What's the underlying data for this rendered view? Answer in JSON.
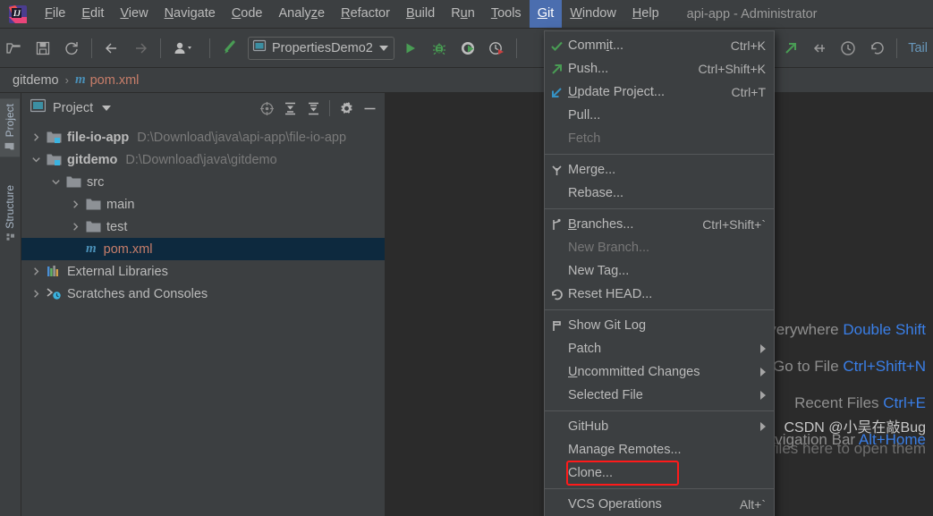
{
  "window": {
    "title": "api-app - Administrator"
  },
  "menubar": {
    "logo_icon": "intellij-idea-logo",
    "items": [
      {
        "label": "File",
        "mnemonic": "F"
      },
      {
        "label": "Edit",
        "mnemonic": "E"
      },
      {
        "label": "View",
        "mnemonic": "V"
      },
      {
        "label": "Navigate",
        "mnemonic": "N"
      },
      {
        "label": "Code",
        "mnemonic": "C"
      },
      {
        "label": "Analyze",
        "mnemonic": "z"
      },
      {
        "label": "Refactor",
        "mnemonic": "R"
      },
      {
        "label": "Build",
        "mnemonic": "B"
      },
      {
        "label": "Run",
        "mnemonic": "u"
      },
      {
        "label": "Tools",
        "mnemonic": "T"
      },
      {
        "label": "Git",
        "mnemonic": "G",
        "active": true
      },
      {
        "label": "Window",
        "mnemonic": "W"
      },
      {
        "label": "Help",
        "mnemonic": "H"
      }
    ]
  },
  "toolbar": {
    "open_icon": "open-folder-icon",
    "save_icon": "save-icon",
    "sync_icon": "refresh-icon",
    "back_icon": "arrow-left-icon",
    "forward_icon": "arrow-right-icon",
    "profile_icon": "user-dropdown-icon",
    "build_icon": "build-hammer-icon",
    "run_config": {
      "label": "PropertiesDemo2",
      "icon": "run-config-icon"
    },
    "run_icon": "run-play-icon",
    "debug_icon": "debug-bug-icon",
    "coverage_icon": "run-with-coverage-icon",
    "profiler_icon": "profiler-icon",
    "jump_icon": "jump-to-source-icon",
    "step_icon": "step-into-icon",
    "history_icon": "clock-history-icon",
    "undo_icon": "undo-icon",
    "right_label": "Tail"
  },
  "breadcrumb": {
    "project": "gitdemo",
    "separator": "›",
    "file_icon_letter": "m",
    "file": "pom.xml"
  },
  "stripe": {
    "tabs": [
      {
        "label": "Project",
        "icon": "project-folder-icon",
        "selected": true
      },
      {
        "label": "Structure",
        "icon": "structure-icon",
        "selected": false
      }
    ]
  },
  "project_panel": {
    "icon": "project-view-icon",
    "title": "Project",
    "dropdown_icon": "chevron-down-icon",
    "header_buttons": [
      {
        "icon": "locate-target-icon",
        "name": "select-opened-file"
      },
      {
        "icon": "expand-all-icon",
        "name": "expand-all"
      },
      {
        "icon": "collapse-all-icon",
        "name": "collapse-all"
      },
      {
        "icon": "gear-icon",
        "name": "settings"
      },
      {
        "icon": "minimize-icon",
        "name": "hide"
      }
    ],
    "tree": [
      {
        "indent": 0,
        "chevron": "right",
        "icon": "module-folder-icon",
        "label": "file-io-app",
        "bold": true,
        "path": "D:\\Download\\java\\api-app\\file-io-app",
        "selected": false
      },
      {
        "indent": 0,
        "chevron": "down",
        "icon": "module-folder-icon",
        "label": "gitdemo",
        "bold": true,
        "path": "D:\\Download\\java\\gitdemo",
        "selected": false
      },
      {
        "indent": 1,
        "chevron": "down",
        "icon": "folder-icon",
        "label": "src",
        "bold": false,
        "path": "",
        "selected": false
      },
      {
        "indent": 2,
        "chevron": "right",
        "icon": "folder-icon",
        "label": "main",
        "bold": false,
        "path": "",
        "selected": false
      },
      {
        "indent": 2,
        "chevron": "right",
        "icon": "folder-icon",
        "label": "test",
        "bold": false,
        "path": "",
        "selected": false
      },
      {
        "indent": 2,
        "chevron": "none",
        "icon": "maven-pom-icon",
        "label": "pom.xml",
        "bold": false,
        "path": "",
        "selected": true
      },
      {
        "indent": 0,
        "chevron": "right",
        "icon": "external-libraries-icon",
        "label": "External Libraries",
        "bold": false,
        "path": "",
        "selected": false
      },
      {
        "indent": 0,
        "chevron": "right",
        "icon": "scratches-icon",
        "label": "Scratches and Consoles",
        "bold": false,
        "path": "",
        "selected": false
      }
    ]
  },
  "editor_tips": [
    {
      "text": "Search Everywhere",
      "key": "Double Shift"
    },
    {
      "text": "Go to File",
      "key": "Ctrl+Shift+N"
    },
    {
      "text": "Recent Files",
      "key": "Ctrl+E"
    },
    {
      "text": "Navigation Bar",
      "key": "Alt+Home"
    }
  ],
  "editor_drop_hint": "Drop files here to open them",
  "watermark": "CSDN @小吴在敲Bug",
  "git_menu": {
    "items": [
      {
        "type": "item",
        "icon": "commit-check-icon",
        "label": "Comm<u>i</u>t...",
        "shortcut": "Ctrl+K"
      },
      {
        "type": "item",
        "icon": "push-arrow-icon",
        "label": "Push...",
        "shortcut": "Ctrl+Shift+K"
      },
      {
        "type": "item",
        "icon": "update-arrow-icon",
        "label": "<u>U</u>pdate Project...",
        "shortcut": "Ctrl+T"
      },
      {
        "type": "item",
        "icon": "",
        "label": "Pull...",
        "shortcut": ""
      },
      {
        "type": "item",
        "icon": "",
        "label": "Fetch",
        "shortcut": "",
        "disabled": true
      },
      {
        "type": "sep"
      },
      {
        "type": "item",
        "icon": "merge-icon",
        "label": "Merge...",
        "shortcut": ""
      },
      {
        "type": "item",
        "icon": "",
        "label": "Rebase...",
        "shortcut": ""
      },
      {
        "type": "sep"
      },
      {
        "type": "item",
        "icon": "branch-icon",
        "label": "<u>B</u>ranches...",
        "shortcut": "Ctrl+Shift+`"
      },
      {
        "type": "item",
        "icon": "",
        "label": "New Branch...",
        "shortcut": "",
        "disabled": true
      },
      {
        "type": "item",
        "icon": "",
        "label": "New Tag...",
        "shortcut": ""
      },
      {
        "type": "item",
        "icon": "reset-icon",
        "label": "Reset HEAD...",
        "shortcut": ""
      },
      {
        "type": "sep"
      },
      {
        "type": "item",
        "icon": "git-log-icon",
        "label": "Show Git Log",
        "shortcut": ""
      },
      {
        "type": "item",
        "icon": "",
        "label": "Patch",
        "shortcut": "",
        "submenu": true
      },
      {
        "type": "item",
        "icon": "",
        "label": "<u>U</u>ncommitted Changes",
        "shortcut": "",
        "submenu": true
      },
      {
        "type": "item",
        "icon": "",
        "label": "Selected File",
        "shortcut": "",
        "submenu": true
      },
      {
        "type": "sep"
      },
      {
        "type": "item",
        "icon": "",
        "label": "GitHub",
        "shortcut": "",
        "submenu": true
      },
      {
        "type": "item",
        "icon": "",
        "label": "Manage Remotes...",
        "shortcut": ""
      },
      {
        "type": "item",
        "icon": "",
        "label": "Clone...",
        "shortcut": "",
        "annotated": true
      },
      {
        "type": "sep"
      },
      {
        "type": "item",
        "icon": "",
        "label": "VCS Operations",
        "shortcut": "Alt+`"
      }
    ]
  },
  "colors": {
    "bg": "#3c3f41",
    "editor_bg": "#2b2b2b",
    "accent_blue": "#4b6eaf",
    "selection": "#0d293e",
    "annotation_red": "#ff1a1a",
    "link_blue": "#3a7fe8",
    "green": "#499c54",
    "text": "#bbbbbb"
  }
}
